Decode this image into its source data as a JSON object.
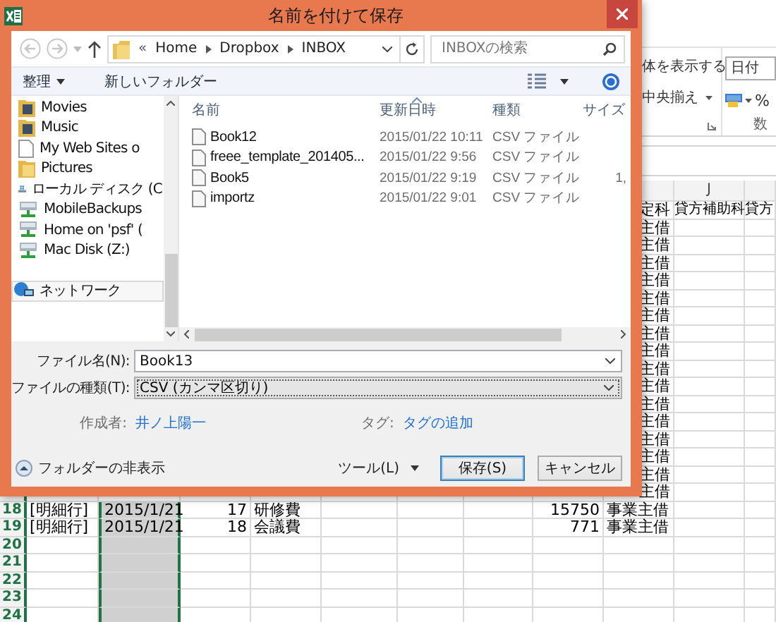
{
  "dialog": {
    "title": "名前を付けて保存",
    "breadcrumb_prefix": "«",
    "path": [
      "Home",
      "Dropbox",
      "INBOX"
    ],
    "search": {
      "placeholder": "INBOXの検索"
    },
    "organize": "整理",
    "new_folder": "新しいフォルダー",
    "nav": [
      {
        "label": "Movies",
        "kind": "media-folder",
        "selected": false
      },
      {
        "label": "Music",
        "kind": "media-folder",
        "selected": false
      },
      {
        "label": "My Web Sites o",
        "kind": "page",
        "selected": false
      },
      {
        "label": "Pictures",
        "kind": "folder",
        "selected": false
      },
      {
        "label": "ローカル ディスク (C",
        "kind": "drive",
        "selected": false
      },
      {
        "label": "MobileBackups",
        "kind": "network-drive",
        "selected": false
      },
      {
        "label": "Home on 'psf' (",
        "kind": "network-drive",
        "selected": false
      },
      {
        "label": "Mac Disk (Z:)",
        "kind": "network-drive",
        "selected": false
      },
      {
        "label": "ネットワーク",
        "kind": "network",
        "selected": true
      }
    ],
    "columns": [
      "名前",
      "更新日時",
      "種類",
      "サイズ"
    ],
    "files": [
      {
        "name": "Book12",
        "modified": "2015/01/22 10:11",
        "type": "CSV ファイル"
      },
      {
        "name": "freee_template_201405...",
        "modified": "2015/01/22 9:56",
        "type": "CSV ファイル"
      },
      {
        "name": "Book5",
        "modified": "2015/01/22 9:19",
        "type": "CSV ファイル",
        "size": "1,"
      },
      {
        "name": "importz",
        "modified": "2015/01/22 9:01",
        "type": "CSV ファイル"
      }
    ],
    "filename": {
      "label": "ファイル名(N):",
      "value": "Book13"
    },
    "filetype": {
      "label": "ファイルの種類(T):",
      "value": "CSV (カンマ区切り)"
    },
    "author": {
      "label": "作成者:",
      "value": "井ノ上陽一"
    },
    "tags": {
      "label": "タグ:",
      "value": "タグの追加"
    },
    "hide_folders": "フォルダーの非表示",
    "tools": "ツール(L)",
    "save": "保存(S)",
    "cancel": "キャンセル"
  },
  "ribbon": {
    "wrap_text": "体を表示する",
    "merge_center": "中央揃え",
    "number_format": "日付",
    "percent": "%",
    "group_label": "数"
  },
  "sheet": {
    "column_header": "J",
    "header_row": {
      "col_i": "定科",
      "col_j": "貸方補助科",
      "col_k": "貸方"
    },
    "upper_rows": [
      {
        "col_i": "主借"
      },
      {
        "col_i": "主借"
      },
      {
        "col_i": "主借"
      },
      {
        "col_i": "主借"
      },
      {
        "col_i": "主借"
      },
      {
        "col_i": "主借"
      },
      {
        "col_i": "主借"
      },
      {
        "col_i": "主借"
      },
      {
        "col_i": "主借"
      },
      {
        "col_i": "主借"
      },
      {
        "col_i": "主借"
      },
      {
        "col_i": "主借"
      },
      {
        "col_i": "主借"
      },
      {
        "col_i": "主借"
      },
      {
        "col_i": "主借"
      },
      {
        "col_i": "主借"
      }
    ],
    "rows": [
      {
        "num": "18",
        "col_a": "[明細行]",
        "col_b": "2015/1/21",
        "col_c": "17",
        "col_d": "研修費",
        "col_h": "15750",
        "col_i": "事業主借"
      },
      {
        "num": "19",
        "col_a": "[明細行]",
        "col_b": "2015/1/21",
        "col_c": "18",
        "col_d": "会議費",
        "col_h": "771",
        "col_i": "事業主借"
      },
      {
        "num": "20"
      },
      {
        "num": "21"
      },
      {
        "num": "22"
      },
      {
        "num": "23"
      },
      {
        "num": "24"
      }
    ]
  }
}
